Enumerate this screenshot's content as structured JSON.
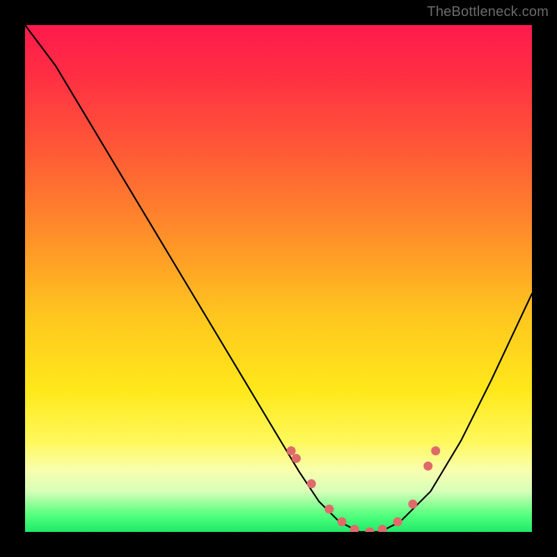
{
  "watermark": "TheBottleneck.com",
  "chart_data": {
    "type": "line",
    "title": "",
    "xlabel": "",
    "ylabel": "",
    "xlim": [
      0,
      1
    ],
    "ylim": [
      0,
      1
    ],
    "series": [
      {
        "name": "curve",
        "x": [
          0.0,
          0.06,
          0.12,
          0.18,
          0.24,
          0.3,
          0.36,
          0.42,
          0.48,
          0.54,
          0.58,
          0.62,
          0.66,
          0.7,
          0.74,
          0.8,
          0.86,
          0.92,
          1.0
        ],
        "y": [
          1.0,
          0.92,
          0.82,
          0.72,
          0.62,
          0.52,
          0.42,
          0.32,
          0.22,
          0.12,
          0.06,
          0.02,
          0.0,
          0.0,
          0.02,
          0.08,
          0.18,
          0.3,
          0.47
        ]
      }
    ],
    "markers": {
      "name": "highlight-dots",
      "color": "#e06a6a",
      "x": [
        0.525,
        0.535,
        0.565,
        0.6,
        0.625,
        0.65,
        0.68,
        0.705,
        0.735,
        0.765,
        0.795,
        0.81
      ],
      "y": [
        0.16,
        0.145,
        0.095,
        0.045,
        0.02,
        0.005,
        0.0,
        0.005,
        0.02,
        0.055,
        0.13,
        0.16
      ]
    },
    "gradient_stops": [
      {
        "pos": 0.0,
        "color": "#ff1a4c"
      },
      {
        "pos": 0.4,
        "color": "#ff8a2a"
      },
      {
        "pos": 0.72,
        "color": "#ffe81a"
      },
      {
        "pos": 0.92,
        "color": "#d6ffb8"
      },
      {
        "pos": 1.0,
        "color": "#20e86a"
      }
    ]
  }
}
